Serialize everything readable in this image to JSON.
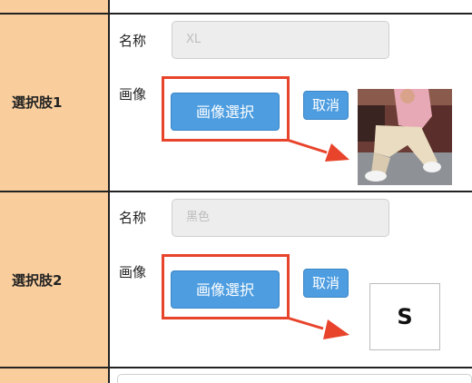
{
  "rows": [
    {
      "label": "選択肢1",
      "name_label": "名称",
      "name_placeholder": "XL",
      "image_label": "画像",
      "select_button": "画像選択",
      "cancel_button": "取消"
    },
    {
      "label": "選択肢2",
      "name_label": "名称",
      "name_placeholder": "黑色",
      "image_label": "画像",
      "select_button": "画像選択",
      "cancel_button": "取消",
      "thumb_letter": "S"
    }
  ],
  "colors": {
    "label_bg": "#f9cd9c",
    "button": "#4d9de0",
    "highlight": "#e8432b"
  }
}
